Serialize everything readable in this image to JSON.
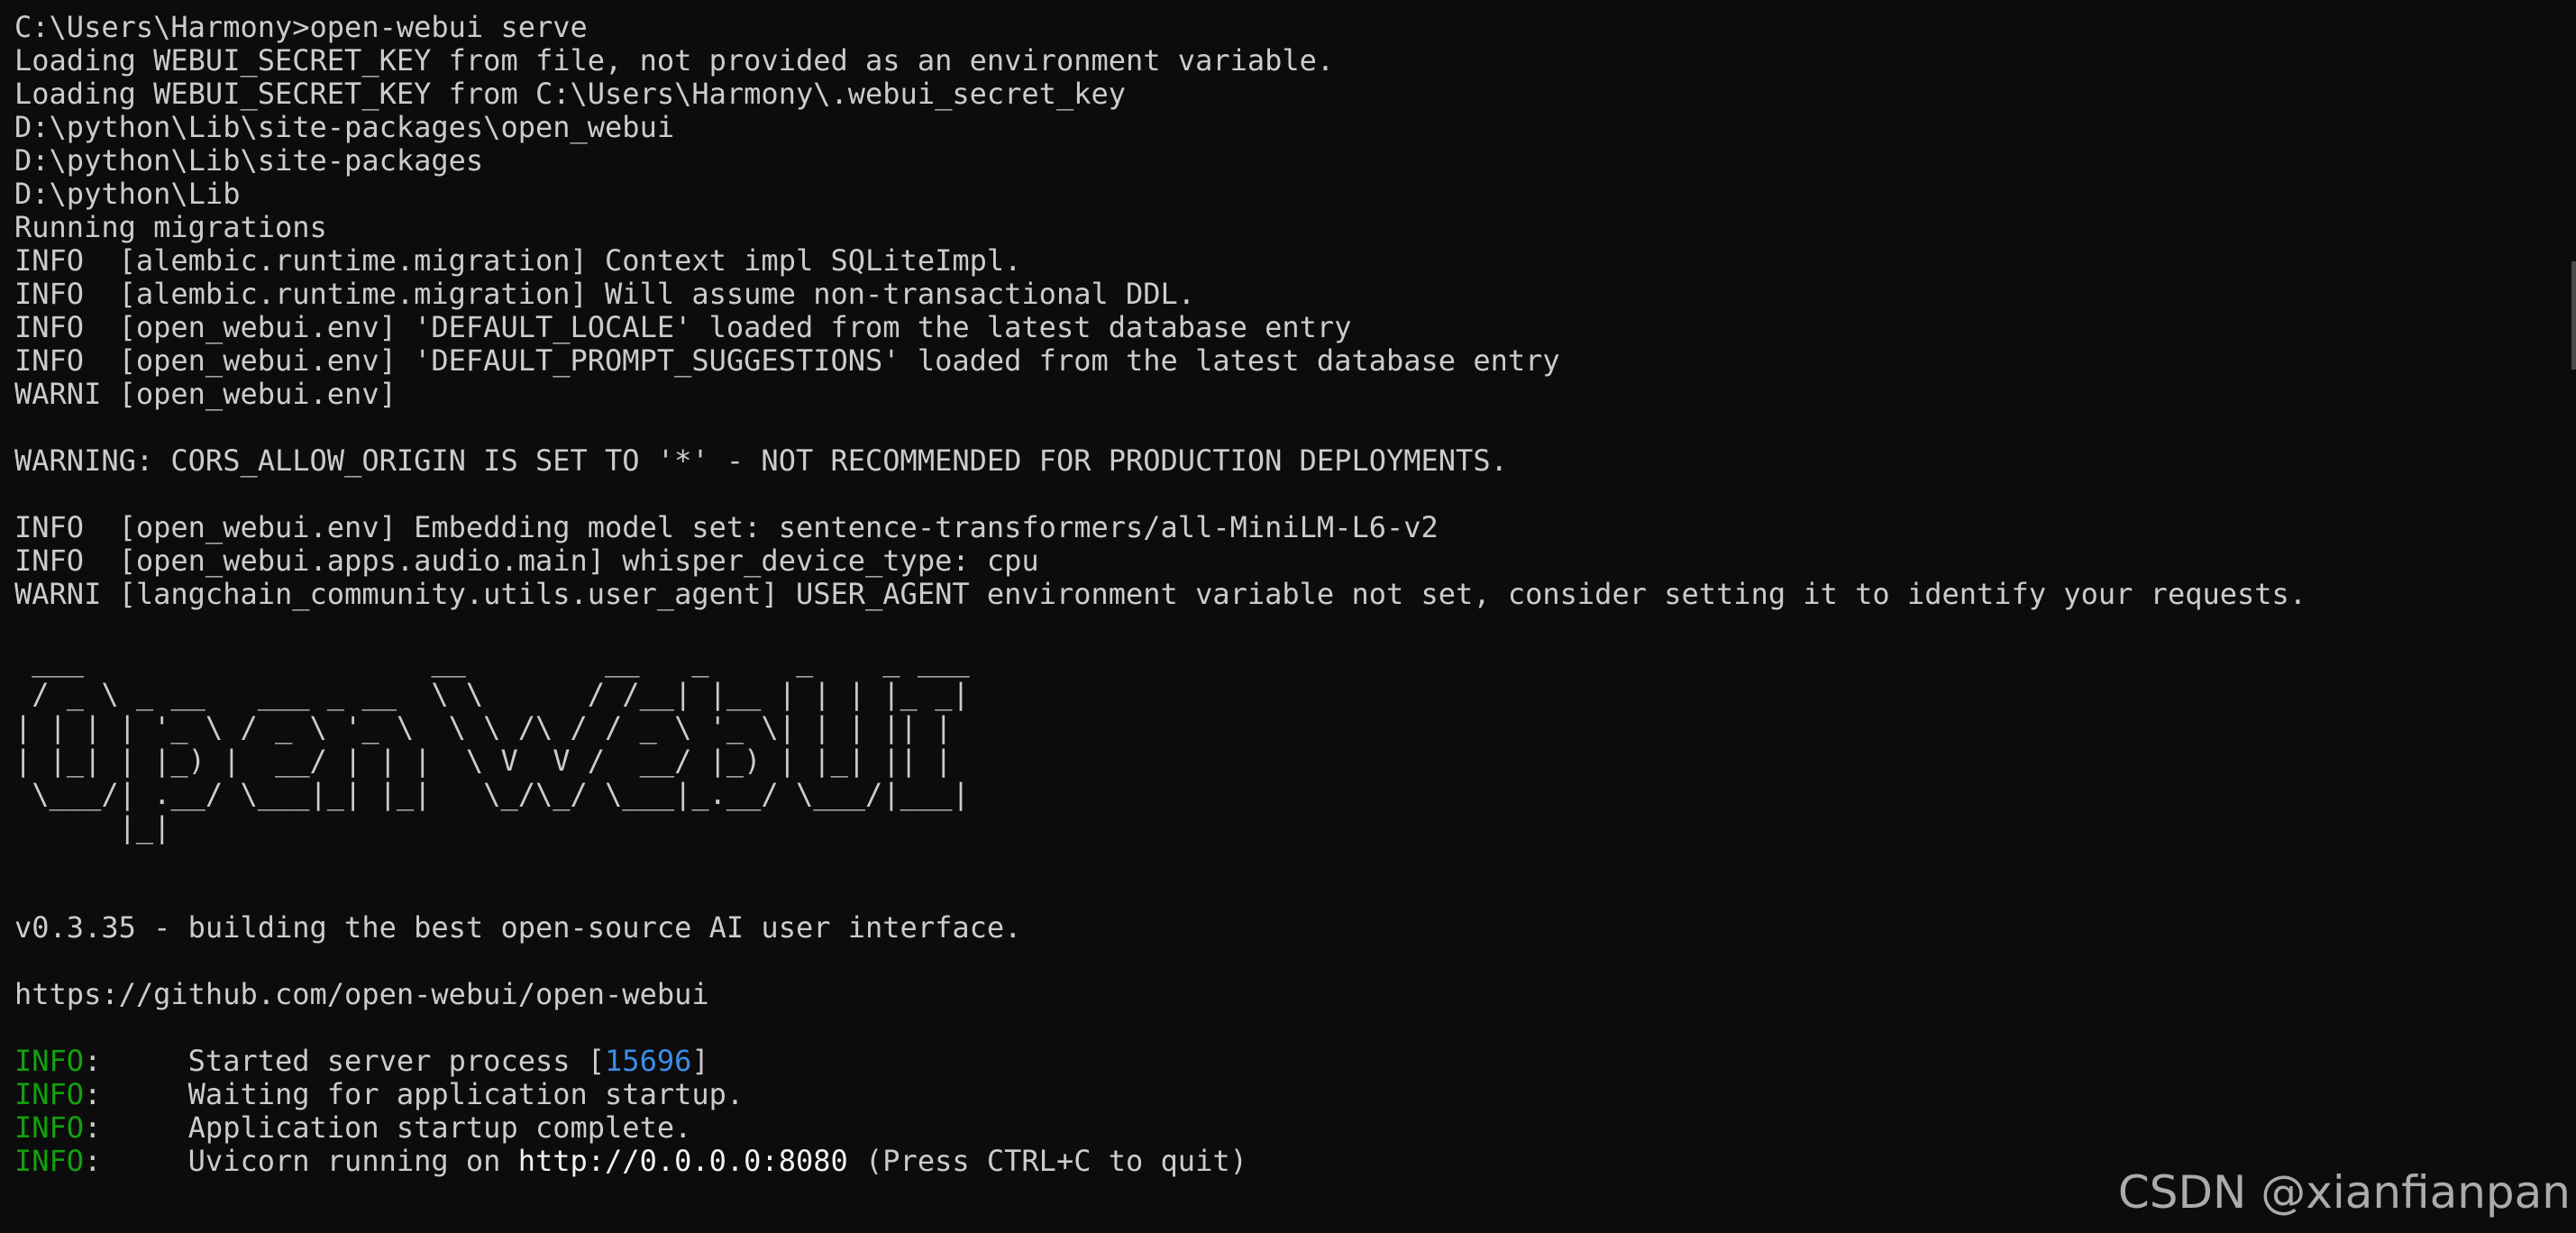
{
  "window": {
    "watermark": "CSDN @xianfianpan"
  },
  "terminal": {
    "command_line": "C:\\Users\\Harmony>open-webui serve",
    "log_lines": [
      "Loading WEBUI_SECRET_KEY from file, not provided as an environment variable.",
      "Loading WEBUI_SECRET_KEY from C:\\Users\\Harmony\\.webui_secret_key",
      "D:\\python\\Lib\\site-packages\\open_webui",
      "D:\\python\\Lib\\site-packages",
      "D:\\python\\Lib",
      "Running migrations",
      "INFO  [alembic.runtime.migration] Context impl SQLiteImpl.",
      "INFO  [alembic.runtime.migration] Will assume non-transactional DDL.",
      "INFO  [open_webui.env] 'DEFAULT_LOCALE' loaded from the latest database entry",
      "INFO  [open_webui.env] 'DEFAULT_PROMPT_SUGGESTIONS' loaded from the latest database entry",
      "WARNI [open_webui.env]"
    ],
    "warning_line": "WARNING: CORS_ALLOW_ORIGIN IS SET TO '*' - NOT RECOMMENDED FOR PRODUCTION DEPLOYMENTS.",
    "log_lines_2": [
      "INFO  [open_webui.env] Embedding model set: sentence-transformers/all-MiniLM-L6-v2",
      "INFO  [open_webui.apps.audio.main] whisper_device_type: cpu",
      "WARNI [langchain_community.utils.user_agent] USER_AGENT environment variable not set, consider setting it to identify your requests."
    ],
    "banner_ascii": " ___                    __        __   _     _    _ ___\n / _ \\ _ __   ___ _ __  \\ \\      / /__| |__ | | | |_ _|\n| | | | '_ \\ / _ \\ '_ \\  \\ \\ /\\ / / _ \\ '_ \\| | | || |\n| |_| | |_) |  __/ | | |  \\ V  V /  __/ |_) | |_| || |\n \\___/| .__/ \\___|_| |_|   \\_/\\_/ \\___|_.__/ \\___/|___|\n      |_|",
    "version_line": "v0.3.35 - building the best open-source AI user interface.",
    "repo_url": "https://github.com/open-webui/open-webui",
    "server": {
      "tag": "INFO",
      "colon": ":",
      "gap": "     ",
      "started_prefix": "Started server process [",
      "pid": "15696",
      "started_suffix": "]",
      "waiting": "Waiting for application startup.",
      "complete": "Application startup complete.",
      "uvicorn_prefix": "Uvicorn running on ",
      "uvicorn_url": "http://0.0.0.0:8080",
      "uvicorn_suffix": " (Press CTRL+C to quit)"
    }
  }
}
